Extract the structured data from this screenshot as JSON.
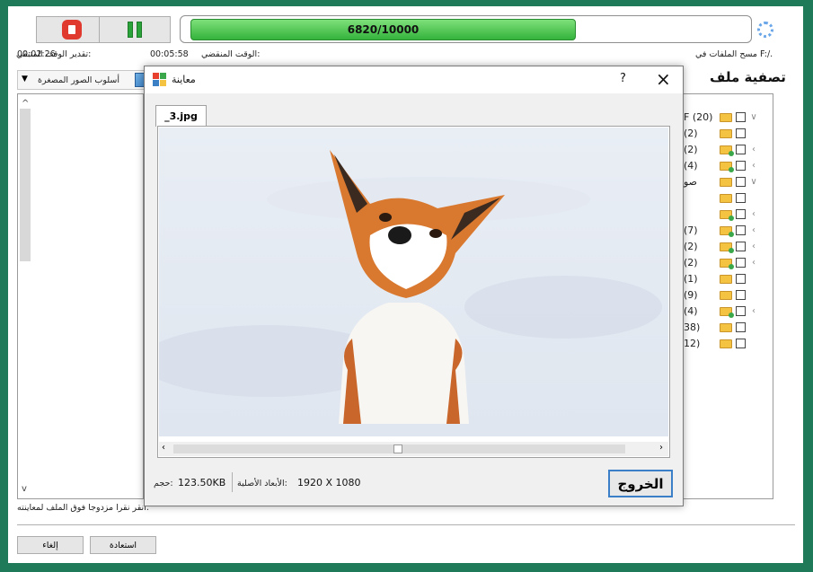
{
  "top": {
    "stop_button": "stop",
    "pause_button": "pause",
    "progress_text": "6820/10000",
    "progress_fraction": 0.682,
    "scan_label": "مسح الملفات في F:/.",
    "elapsed_label": "الوقت المنقضي:",
    "elapsed_value": "00:05:58",
    "remaining_label": "تقدير الوقت المتبقي:",
    "remaining_value": "00:02:26"
  },
  "toolbar": {
    "view_mode": "أسلوب الصور المصغرة",
    "filter_title": "تصفية ملف"
  },
  "tree": {
    "items": [
      {
        "label": "F (20)",
        "chev": "∨",
        "green": false
      },
      {
        "label": "(2)",
        "chev": "",
        "green": false
      },
      {
        "label": "(2)",
        "chev": "‹",
        "green": true
      },
      {
        "label": "(4)",
        "chev": "‹",
        "green": true
      },
      {
        "label": "صو",
        "chev": "∨",
        "green": false
      },
      {
        "label": "",
        "chev": "",
        "green": false
      },
      {
        "label": "",
        "chev": "‹",
        "green": true
      },
      {
        "label": "(7)",
        "chev": "‹",
        "green": true
      },
      {
        "label": "(2)",
        "chev": "‹",
        "green": true
      },
      {
        "label": "(2)",
        "chev": "‹",
        "green": true
      },
      {
        "label": "(1)",
        "chev": "",
        "green": false
      },
      {
        "label": "(9)",
        "chev": "",
        "green": false
      },
      {
        "label": "(4)",
        "chev": "‹",
        "green": true
      },
      {
        "label": "38)",
        "chev": "",
        "green": false
      },
      {
        "label": "12)",
        "chev": "",
        "green": false
      }
    ]
  },
  "status_hint": "انقر نقرا مزدوجا فوق الملف لمعاينته.",
  "bottom": {
    "restore_button": "استعادة",
    "cancel_button": "إلغاء"
  },
  "dialog": {
    "title": "معاينة",
    "help_label": "?",
    "close_label": "×",
    "tab_label": "_3.jpg",
    "size_label": "حجم:",
    "size_value": "123.50KB",
    "dims_label": "الأبعاد الأصلية:",
    "dims_value": "1920 X 1080",
    "exit_button": "الخروج"
  }
}
